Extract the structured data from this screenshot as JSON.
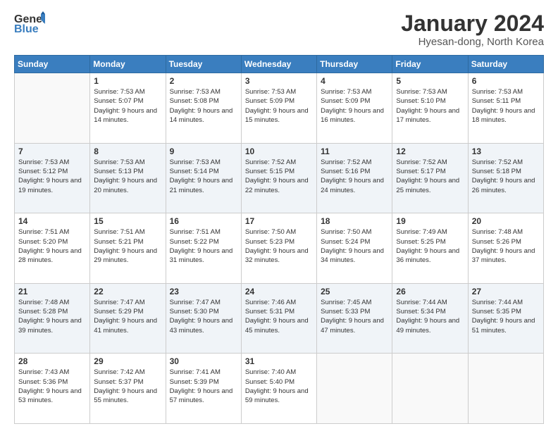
{
  "logo": {
    "general": "General",
    "blue": "Blue"
  },
  "title": "January 2024",
  "subtitle": "Hyesan-dong, North Korea",
  "days_of_week": [
    "Sunday",
    "Monday",
    "Tuesday",
    "Wednesday",
    "Thursday",
    "Friday",
    "Saturday"
  ],
  "weeks": [
    [
      {
        "day": "",
        "sunrise": "",
        "sunset": "",
        "daylight": ""
      },
      {
        "day": "1",
        "sunrise": "Sunrise: 7:53 AM",
        "sunset": "Sunset: 5:07 PM",
        "daylight": "Daylight: 9 hours and 14 minutes."
      },
      {
        "day": "2",
        "sunrise": "Sunrise: 7:53 AM",
        "sunset": "Sunset: 5:08 PM",
        "daylight": "Daylight: 9 hours and 14 minutes."
      },
      {
        "day": "3",
        "sunrise": "Sunrise: 7:53 AM",
        "sunset": "Sunset: 5:09 PM",
        "daylight": "Daylight: 9 hours and 15 minutes."
      },
      {
        "day": "4",
        "sunrise": "Sunrise: 7:53 AM",
        "sunset": "Sunset: 5:09 PM",
        "daylight": "Daylight: 9 hours and 16 minutes."
      },
      {
        "day": "5",
        "sunrise": "Sunrise: 7:53 AM",
        "sunset": "Sunset: 5:10 PM",
        "daylight": "Daylight: 9 hours and 17 minutes."
      },
      {
        "day": "6",
        "sunrise": "Sunrise: 7:53 AM",
        "sunset": "Sunset: 5:11 PM",
        "daylight": "Daylight: 9 hours and 18 minutes."
      }
    ],
    [
      {
        "day": "7",
        "sunrise": "Sunrise: 7:53 AM",
        "sunset": "Sunset: 5:12 PM",
        "daylight": "Daylight: 9 hours and 19 minutes."
      },
      {
        "day": "8",
        "sunrise": "Sunrise: 7:53 AM",
        "sunset": "Sunset: 5:13 PM",
        "daylight": "Daylight: 9 hours and 20 minutes."
      },
      {
        "day": "9",
        "sunrise": "Sunrise: 7:53 AM",
        "sunset": "Sunset: 5:14 PM",
        "daylight": "Daylight: 9 hours and 21 minutes."
      },
      {
        "day": "10",
        "sunrise": "Sunrise: 7:52 AM",
        "sunset": "Sunset: 5:15 PM",
        "daylight": "Daylight: 9 hours and 22 minutes."
      },
      {
        "day": "11",
        "sunrise": "Sunrise: 7:52 AM",
        "sunset": "Sunset: 5:16 PM",
        "daylight": "Daylight: 9 hours and 24 minutes."
      },
      {
        "day": "12",
        "sunrise": "Sunrise: 7:52 AM",
        "sunset": "Sunset: 5:17 PM",
        "daylight": "Daylight: 9 hours and 25 minutes."
      },
      {
        "day": "13",
        "sunrise": "Sunrise: 7:52 AM",
        "sunset": "Sunset: 5:18 PM",
        "daylight": "Daylight: 9 hours and 26 minutes."
      }
    ],
    [
      {
        "day": "14",
        "sunrise": "Sunrise: 7:51 AM",
        "sunset": "Sunset: 5:20 PM",
        "daylight": "Daylight: 9 hours and 28 minutes."
      },
      {
        "day": "15",
        "sunrise": "Sunrise: 7:51 AM",
        "sunset": "Sunset: 5:21 PM",
        "daylight": "Daylight: 9 hours and 29 minutes."
      },
      {
        "day": "16",
        "sunrise": "Sunrise: 7:51 AM",
        "sunset": "Sunset: 5:22 PM",
        "daylight": "Daylight: 9 hours and 31 minutes."
      },
      {
        "day": "17",
        "sunrise": "Sunrise: 7:50 AM",
        "sunset": "Sunset: 5:23 PM",
        "daylight": "Daylight: 9 hours and 32 minutes."
      },
      {
        "day": "18",
        "sunrise": "Sunrise: 7:50 AM",
        "sunset": "Sunset: 5:24 PM",
        "daylight": "Daylight: 9 hours and 34 minutes."
      },
      {
        "day": "19",
        "sunrise": "Sunrise: 7:49 AM",
        "sunset": "Sunset: 5:25 PM",
        "daylight": "Daylight: 9 hours and 36 minutes."
      },
      {
        "day": "20",
        "sunrise": "Sunrise: 7:48 AM",
        "sunset": "Sunset: 5:26 PM",
        "daylight": "Daylight: 9 hours and 37 minutes."
      }
    ],
    [
      {
        "day": "21",
        "sunrise": "Sunrise: 7:48 AM",
        "sunset": "Sunset: 5:28 PM",
        "daylight": "Daylight: 9 hours and 39 minutes."
      },
      {
        "day": "22",
        "sunrise": "Sunrise: 7:47 AM",
        "sunset": "Sunset: 5:29 PM",
        "daylight": "Daylight: 9 hours and 41 minutes."
      },
      {
        "day": "23",
        "sunrise": "Sunrise: 7:47 AM",
        "sunset": "Sunset: 5:30 PM",
        "daylight": "Daylight: 9 hours and 43 minutes."
      },
      {
        "day": "24",
        "sunrise": "Sunrise: 7:46 AM",
        "sunset": "Sunset: 5:31 PM",
        "daylight": "Daylight: 9 hours and 45 minutes."
      },
      {
        "day": "25",
        "sunrise": "Sunrise: 7:45 AM",
        "sunset": "Sunset: 5:33 PM",
        "daylight": "Daylight: 9 hours and 47 minutes."
      },
      {
        "day": "26",
        "sunrise": "Sunrise: 7:44 AM",
        "sunset": "Sunset: 5:34 PM",
        "daylight": "Daylight: 9 hours and 49 minutes."
      },
      {
        "day": "27",
        "sunrise": "Sunrise: 7:44 AM",
        "sunset": "Sunset: 5:35 PM",
        "daylight": "Daylight: 9 hours and 51 minutes."
      }
    ],
    [
      {
        "day": "28",
        "sunrise": "Sunrise: 7:43 AM",
        "sunset": "Sunset: 5:36 PM",
        "daylight": "Daylight: 9 hours and 53 minutes."
      },
      {
        "day": "29",
        "sunrise": "Sunrise: 7:42 AM",
        "sunset": "Sunset: 5:37 PM",
        "daylight": "Daylight: 9 hours and 55 minutes."
      },
      {
        "day": "30",
        "sunrise": "Sunrise: 7:41 AM",
        "sunset": "Sunset: 5:39 PM",
        "daylight": "Daylight: 9 hours and 57 minutes."
      },
      {
        "day": "31",
        "sunrise": "Sunrise: 7:40 AM",
        "sunset": "Sunset: 5:40 PM",
        "daylight": "Daylight: 9 hours and 59 minutes."
      },
      {
        "day": "",
        "sunrise": "",
        "sunset": "",
        "daylight": ""
      },
      {
        "day": "",
        "sunrise": "",
        "sunset": "",
        "daylight": ""
      },
      {
        "day": "",
        "sunrise": "",
        "sunset": "",
        "daylight": ""
      }
    ]
  ]
}
